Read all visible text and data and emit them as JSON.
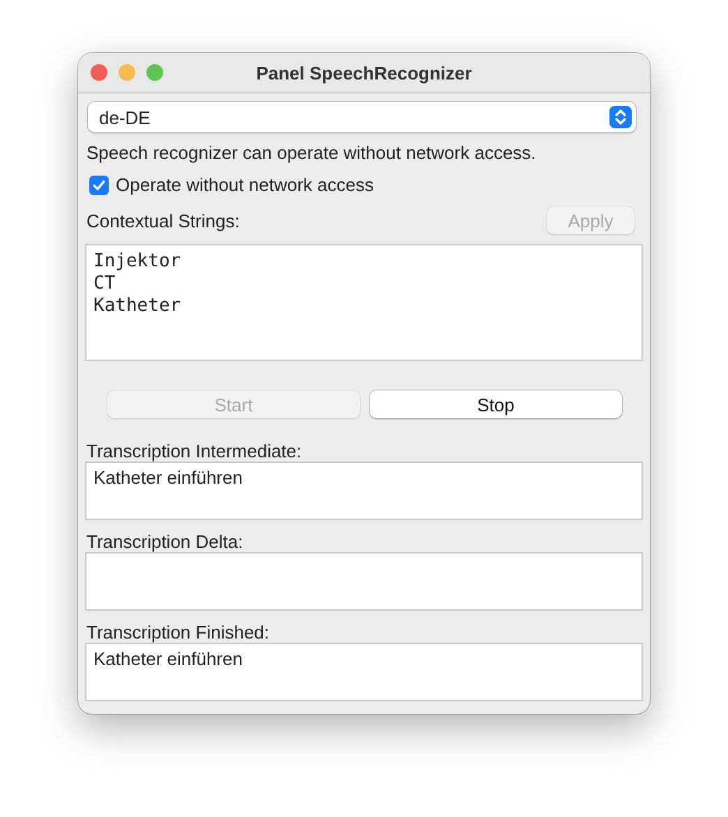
{
  "window": {
    "title": "Panel SpeechRecognizer"
  },
  "locale_popup": {
    "value": "de-DE"
  },
  "status_text": "Speech recognizer can operate without network access.",
  "offline_checkbox": {
    "label": "Operate without network access",
    "checked": true
  },
  "contextual_strings": {
    "label": "Contextual Strings:",
    "apply_button": {
      "label": "Apply",
      "disabled": true
    },
    "lines": [
      "Injektor",
      "CT",
      "Katheter"
    ]
  },
  "buttons": [
    {
      "label": "Start",
      "disabled": true
    },
    {
      "label": "Stop",
      "disabled": false
    }
  ],
  "transcriptions": [
    {
      "label": "Transcription Intermediate:",
      "value": "Katheter einführen"
    },
    {
      "label": "Transcription Delta:"
    },
    {
      "label": "Transcription Finished:",
      "value": "Katheter einführen"
    }
  ]
}
